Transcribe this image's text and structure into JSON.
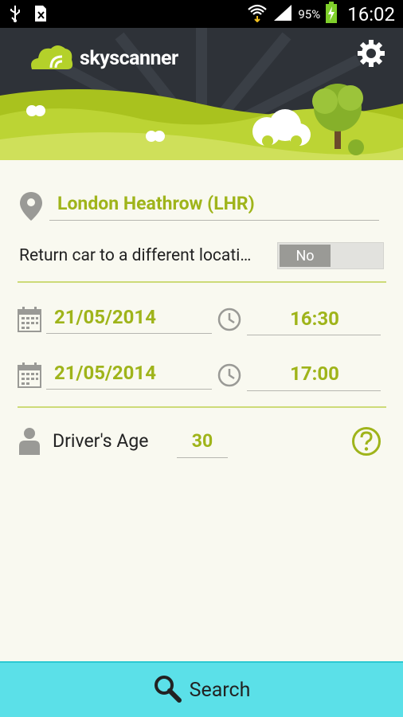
{
  "status_bar": {
    "battery": "95%",
    "time": "16:02"
  },
  "header": {
    "app_name": "skyscanner"
  },
  "form": {
    "pickup_location": "London Heathrow (LHR)",
    "return_label": "Return car to a different locati…",
    "return_toggle": "No",
    "pickup_date": "21/05/2014",
    "pickup_time": "16:30",
    "dropoff_date": "21/05/2014",
    "dropoff_time": "17:00",
    "driver_age_label": "Driver's Age",
    "driver_age": "30"
  },
  "footer": {
    "search_label": "Search"
  },
  "colors": {
    "accent": "#9fb41a",
    "header_dark": "#2e3238",
    "search_bar": "#5be0e8"
  }
}
